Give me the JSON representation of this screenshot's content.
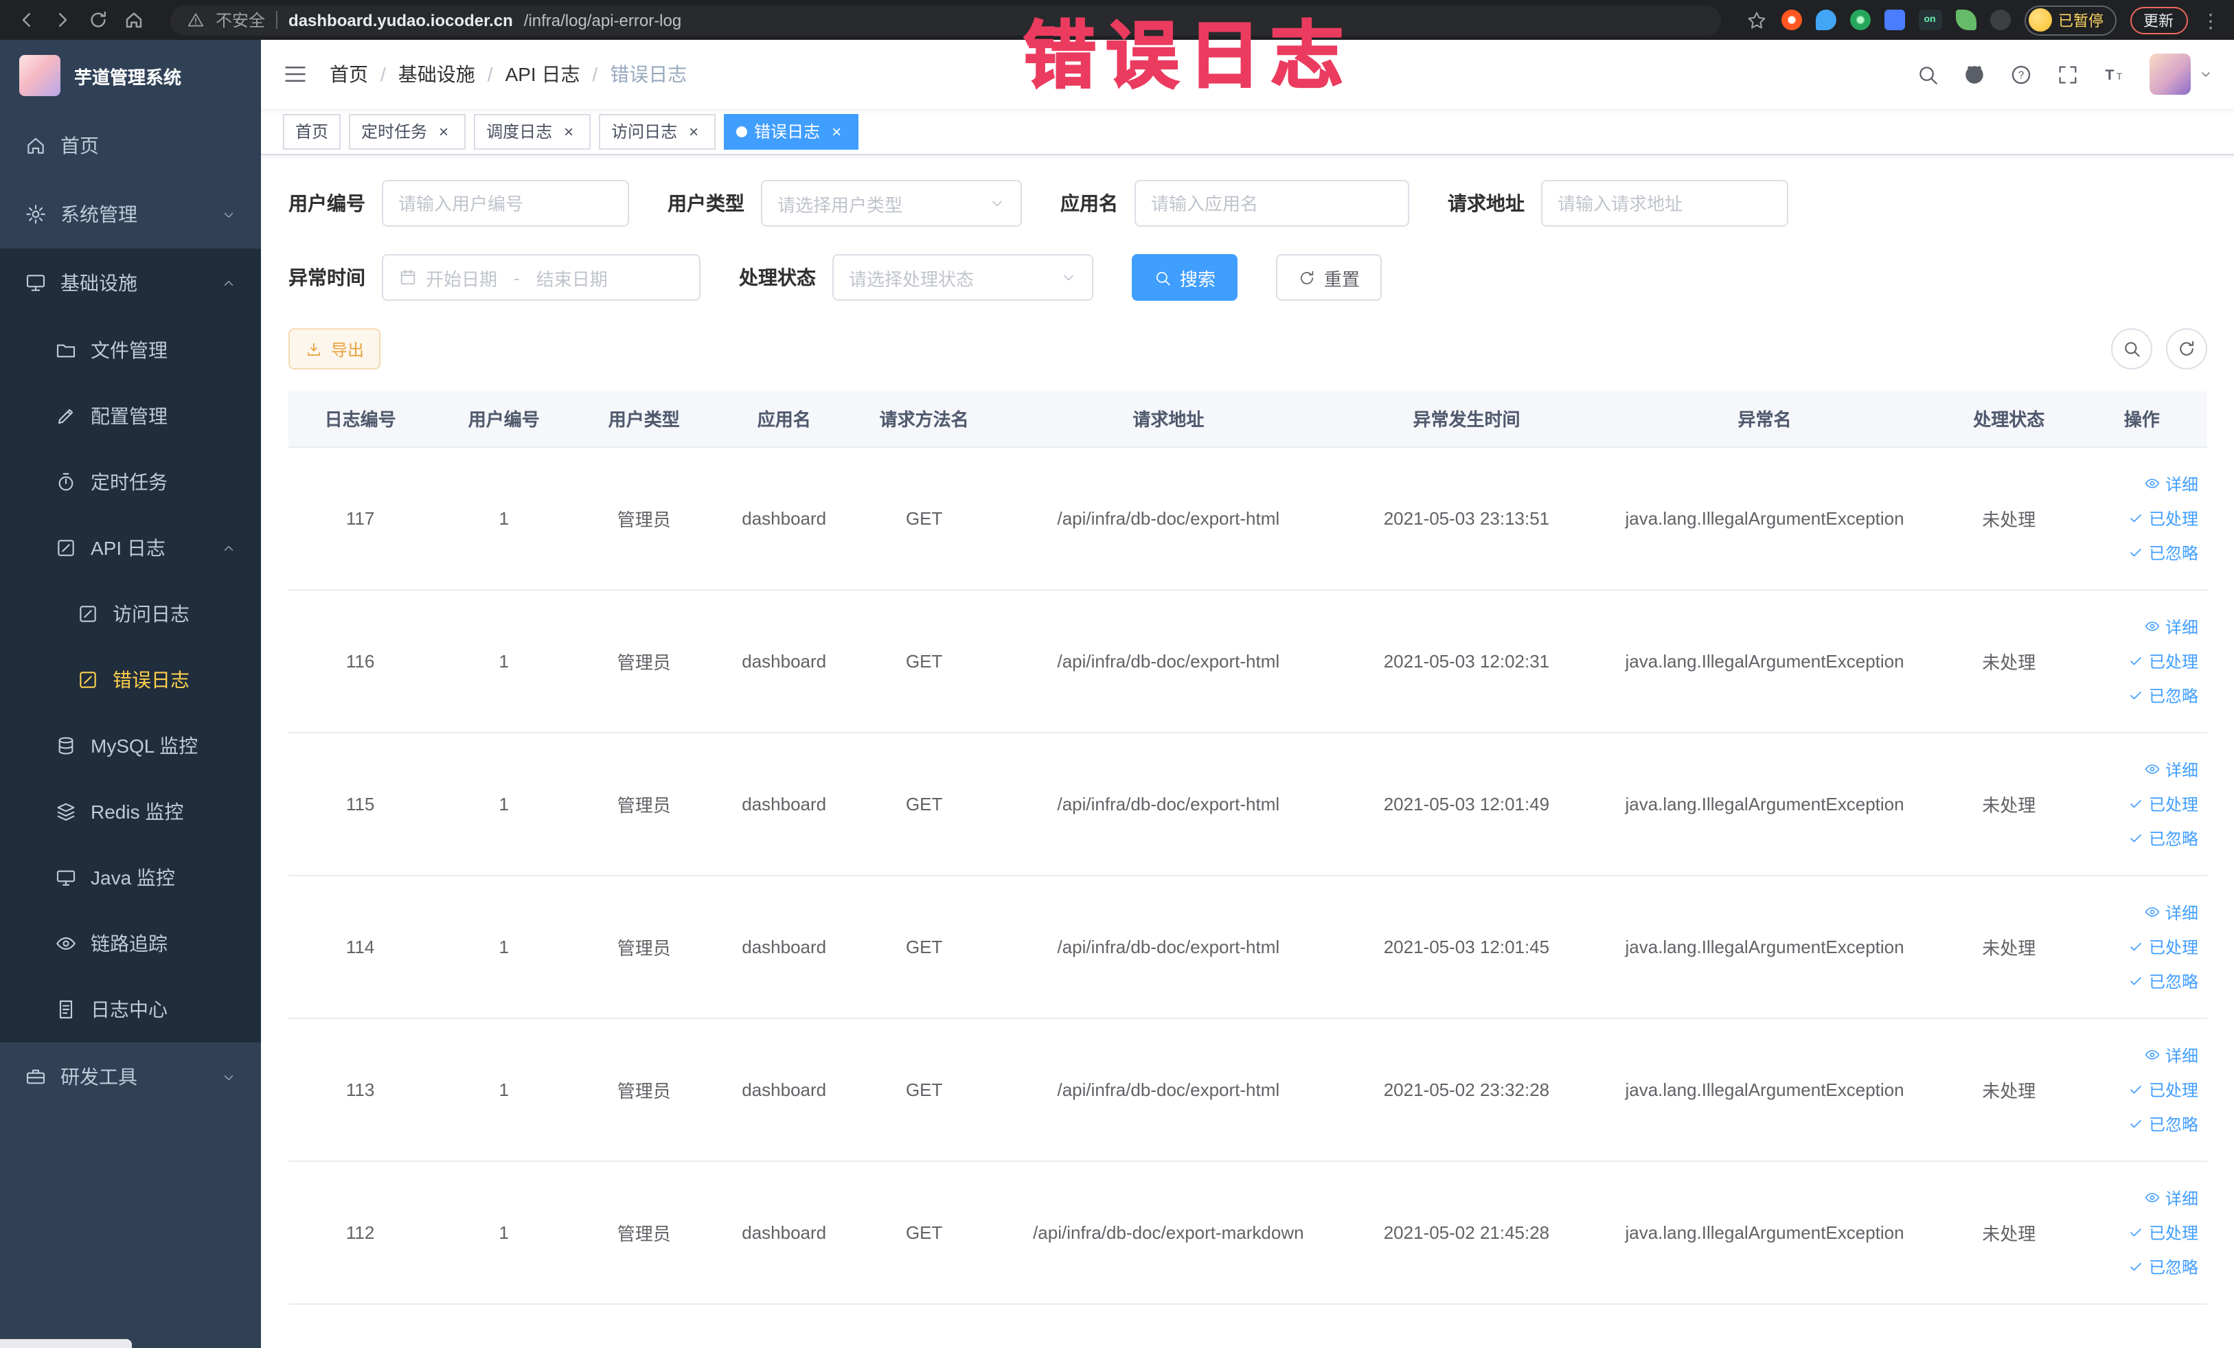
{
  "browser": {
    "security_label": "不安全",
    "url_host": "dashboard.yudao.iocoder.cn",
    "url_path": "/infra/log/api-error-log",
    "profile_badge": "已暂停",
    "update_button": "更新",
    "ext_on_label": "on"
  },
  "annotation": {
    "text": "错误日志",
    "color": "#eb3b5f"
  },
  "sidebar": {
    "logo_title": "芋道管理系统",
    "items": [
      {
        "key": "home",
        "label": "首页",
        "icon": "home",
        "level": 0
      },
      {
        "key": "system-management",
        "label": "系统管理",
        "icon": "gear",
        "level": 0,
        "chevron": "down"
      },
      {
        "key": "infrastructure",
        "label": "基础设施",
        "icon": "infra",
        "level": 0,
        "chevron": "up",
        "open": true
      },
      {
        "key": "file-management",
        "label": "文件管理",
        "icon": "file",
        "level": 1
      },
      {
        "key": "config-management",
        "label": "配置管理",
        "icon": "config",
        "level": 1
      },
      {
        "key": "scheduled-jobs",
        "label": "定时任务",
        "icon": "job",
        "level": 1
      },
      {
        "key": "api-log",
        "label": "API 日志",
        "icon": "apilog",
        "level": 1,
        "chevron": "up",
        "open": true
      },
      {
        "key": "access-log",
        "label": "访问日志",
        "icon": "apilog",
        "level": 2
      },
      {
        "key": "error-log",
        "label": "错误日志",
        "icon": "apilog",
        "level": 2,
        "active": true
      },
      {
        "key": "mysql-monitor",
        "label": "MySQL 监控",
        "icon": "mysql",
        "level": 1
      },
      {
        "key": "redis-monitor",
        "label": "Redis 监控",
        "icon": "redis",
        "level": 1
      },
      {
        "key": "java-monitor",
        "label": "Java 监控",
        "icon": "java",
        "level": 1
      },
      {
        "key": "tracing",
        "label": "链路追踪",
        "icon": "trace",
        "level": 1
      },
      {
        "key": "log-center",
        "label": "日志中心",
        "icon": "logcenter",
        "level": 1
      },
      {
        "key": "dev-tools",
        "label": "研发工具",
        "icon": "tools",
        "level": 0,
        "chevron": "down"
      }
    ]
  },
  "navbar": {
    "breadcrumb": [
      "首页",
      "基础设施",
      "API 日志",
      "错误日志"
    ]
  },
  "tabs": [
    {
      "label": "首页",
      "closable": false,
      "active": false
    },
    {
      "label": "定时任务",
      "closable": true,
      "active": false
    },
    {
      "label": "调度日志",
      "closable": true,
      "active": false
    },
    {
      "label": "访问日志",
      "closable": true,
      "active": false
    },
    {
      "label": "错误日志",
      "closable": true,
      "active": true
    }
  ],
  "filters": {
    "user_id": {
      "label": "用户编号",
      "placeholder": "请输入用户编号"
    },
    "user_type": {
      "label": "用户类型",
      "placeholder": "请选择用户类型"
    },
    "app_name": {
      "label": "应用名",
      "placeholder": "请输入应用名"
    },
    "request_url": {
      "label": "请求地址",
      "placeholder": "请输入请求地址"
    },
    "exception_time": {
      "label": "异常时间",
      "start_placeholder": "开始日期",
      "separator": "-",
      "end_placeholder": "结束日期"
    },
    "process_status": {
      "label": "处理状态",
      "placeholder": "请选择处理状态"
    },
    "search_button": "搜索",
    "reset_button": "重置"
  },
  "toolbar": {
    "export_button": "导出"
  },
  "table": {
    "columns": [
      "日志编号",
      "用户编号",
      "用户类型",
      "应用名",
      "请求方法名",
      "请求地址",
      "异常发生时间",
      "异常名",
      "处理状态",
      "操作"
    ],
    "action_labels": [
      "详细",
      "已处理",
      "已忽略"
    ],
    "rows": [
      {
        "id": "117",
        "user_id": "1",
        "user_type": "管理员",
        "app": "dashboard",
        "method": "GET",
        "url": "/api/infra/db-doc/export-html",
        "time": "2021-05-03 23:13:51",
        "exception": "java.lang.IllegalArgumentException",
        "status": "未处理"
      },
      {
        "id": "116",
        "user_id": "1",
        "user_type": "管理员",
        "app": "dashboard",
        "method": "GET",
        "url": "/api/infra/db-doc/export-html",
        "time": "2021-05-03 12:02:31",
        "exception": "java.lang.IllegalArgumentException",
        "status": "未处理"
      },
      {
        "id": "115",
        "user_id": "1",
        "user_type": "管理员",
        "app": "dashboard",
        "method": "GET",
        "url": "/api/infra/db-doc/export-html",
        "time": "2021-05-03 12:01:49",
        "exception": "java.lang.IllegalArgumentException",
        "status": "未处理"
      },
      {
        "id": "114",
        "user_id": "1",
        "user_type": "管理员",
        "app": "dashboard",
        "method": "GET",
        "url": "/api/infra/db-doc/export-html",
        "time": "2021-05-03 12:01:45",
        "exception": "java.lang.IllegalArgumentException",
        "status": "未处理"
      },
      {
        "id": "113",
        "user_id": "1",
        "user_type": "管理员",
        "app": "dashboard",
        "method": "GET",
        "url": "/api/infra/db-doc/export-html",
        "time": "2021-05-02 23:32:28",
        "exception": "java.lang.IllegalArgumentException",
        "status": "未处理"
      },
      {
        "id": "112",
        "user_id": "1",
        "user_type": "管理员",
        "app": "dashboard",
        "method": "GET",
        "url": "/api/infra/db-doc/export-markdown",
        "time": "2021-05-02 21:45:28",
        "exception": "java.lang.IllegalArgumentException",
        "status": "未处理"
      }
    ]
  },
  "colors": {
    "accent": "#409eff",
    "sidebar_active": "#ffd04b",
    "warning": "#e6a23c"
  }
}
